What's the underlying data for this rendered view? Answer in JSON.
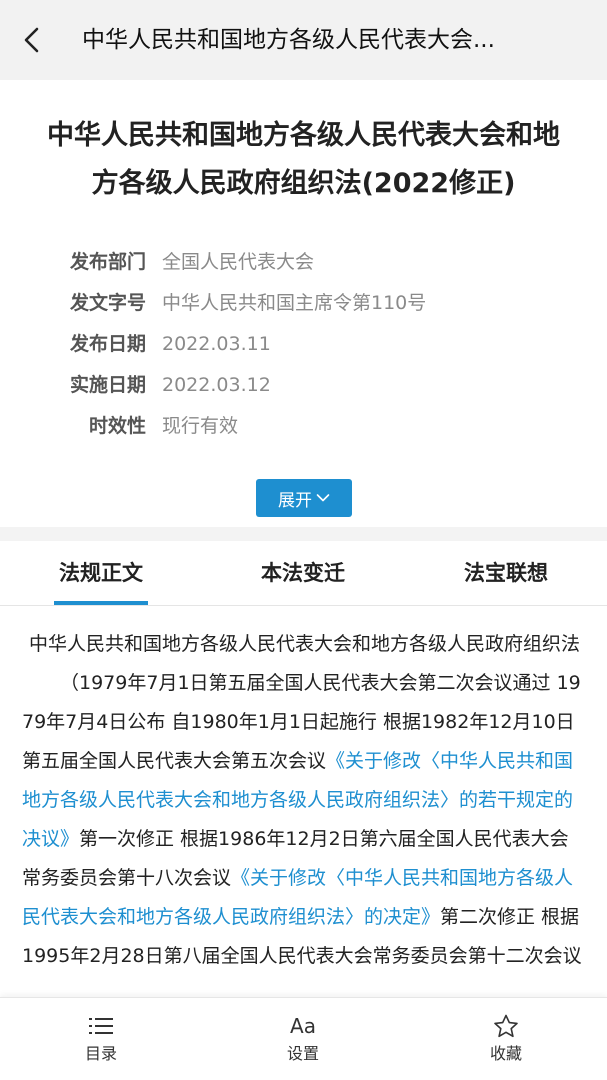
{
  "header": {
    "back_icon": "chevron-left-icon",
    "title": "中华人民共和国地方各级人民代表大会..."
  },
  "document": {
    "title_line1": "中华人民共和国地方各级人民代表大会和地",
    "title_line2": "方各级人民政府组织法(2022修正)",
    "meta": [
      {
        "label": "发布部门",
        "value": "全国人民代表大会"
      },
      {
        "label": "发文字号",
        "value": "中华人民共和国主席令第110号"
      },
      {
        "label": "发布日期",
        "value": "2022.03.11"
      },
      {
        "label": "实施日期",
        "value": "2022.03.12"
      },
      {
        "label": "时效性",
        "value": "现行有效"
      }
    ],
    "expand_label": "展开",
    "expand_icon": "chevron-down-icon"
  },
  "tabs": [
    {
      "label": "法规正文",
      "active": true
    },
    {
      "label": "本法变迁",
      "active": false
    },
    {
      "label": "法宝联想",
      "active": false
    }
  ],
  "content": {
    "heading": "中华人民共和国地方各级人民代表大会和地方各级人民政府组织法",
    "p1": "（1979年7月1日第五届全国人民代表大会第二次会议通过 1979年7月4日公布 自1980年1月1日起施行 根据1982年12月10日第五届全国人民代表大会第五次会议",
    "link1": "《关于修改〈中华人民共和国地方各级人民代表大会和地方各级人民政府组织法〉的若干规定的决议》",
    "p2": "第一次修正 根据1986年12月2日第六届全国人民代表大会常务委员会第十八次会议",
    "link2": "《关于修改〈中华人民共和国地方各级人民代表大会和地方各级人民政府组织法〉的决定》",
    "p3": "第二次修正 根据1995年2月28日第八届全国人民代表大会常务委员会第十二次会议"
  },
  "bottom_bar": [
    {
      "label": "目录",
      "icon": "list-icon"
    },
    {
      "label": "设置",
      "icon": "font-size-icon",
      "glyph": "Aa"
    },
    {
      "label": "收藏",
      "icon": "star-icon"
    }
  ],
  "colors": {
    "accent": "#1e8fd0",
    "nav_bg": "#f2f2f2",
    "meta_value": "#8a8a8a"
  }
}
